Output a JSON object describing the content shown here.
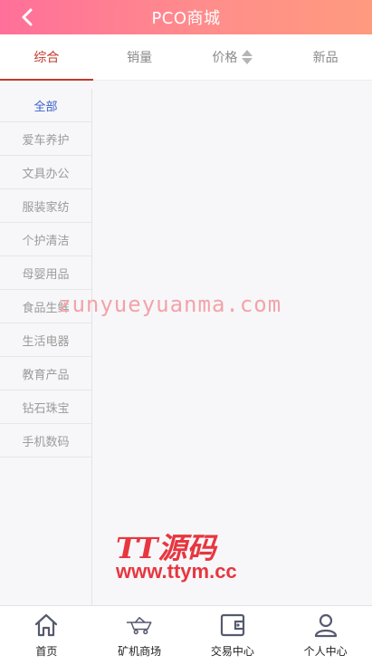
{
  "header": {
    "title": "PCO商城"
  },
  "sort_tabs": [
    {
      "label": "综合"
    },
    {
      "label": "销量"
    },
    {
      "label": "价格"
    },
    {
      "label": "新品"
    }
  ],
  "categories": [
    "全部",
    "爱车养护",
    "文具办公",
    "服装家纺",
    "个护清洁",
    "母婴用品",
    "食品生鲜",
    "生活电器",
    "教育产品",
    "钻石珠宝",
    "手机数码"
  ],
  "watermarks": {
    "site": "zunyueyuanma.com",
    "brand": "TT源码",
    "url": "www.ttym.cc"
  },
  "tabbar": [
    {
      "label": "首页",
      "icon": "home-icon"
    },
    {
      "label": "矿机商场",
      "icon": "mining-cart-icon"
    },
    {
      "label": "交易中心",
      "icon": "wallet-icon"
    },
    {
      "label": "个人中心",
      "icon": "user-icon"
    }
  ],
  "colors": {
    "header_gradient_start": "#ff6f9a",
    "header_gradient_end": "#ff9a7e",
    "active_tab": "#c0392b",
    "active_category": "#3a5fcd"
  }
}
